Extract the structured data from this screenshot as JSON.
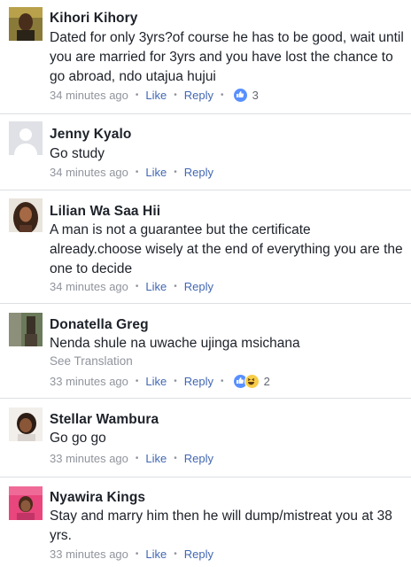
{
  "comments": [
    {
      "name": "Kihori Kihory",
      "text": "Dated for only 3yrs?of course he has to be good, wait until you are married for 3yrs and you have lost the chance to go abroad, ndo utajua hujui",
      "time": "34 minutes ago",
      "like": "Like",
      "reply": "Reply",
      "reaction_count": "3",
      "reactions": [
        "like-icon"
      ]
    },
    {
      "name": "Jenny Kyalo",
      "text": "Go study",
      "time": "34 minutes ago",
      "like": "Like",
      "reply": "Reply"
    },
    {
      "name": "Lilian Wa Saa Hii",
      "text": "A man is not a guarantee but the certificate already.choose wisely at the end of everything  you are the one to decide",
      "time": "34 minutes ago",
      "like": "Like",
      "reply": "Reply"
    },
    {
      "name": "Donatella Greg",
      "text": "Nenda shule na uwache ujinga msichana",
      "see_translation": "See Translation",
      "time": "33 minutes ago",
      "like": "Like",
      "reply": "Reply",
      "reaction_count": "2",
      "reactions": [
        "like-icon",
        "haha-icon"
      ]
    },
    {
      "name": "Stellar Wambura",
      "text": "Go go go",
      "time": "33 minutes ago",
      "like": "Like",
      "reply": "Reply"
    },
    {
      "name": "Nyawira Kings",
      "text": "Stay and marry him then he will dump/mistreat you at 38 yrs.",
      "time": "33 minutes ago",
      "like": "Like",
      "reply": "Reply"
    }
  ],
  "colors": {
    "link": "#4267b2",
    "meta": "#90949c",
    "like_reaction": "#5890ff",
    "haha_reaction": "#f7cd48"
  }
}
